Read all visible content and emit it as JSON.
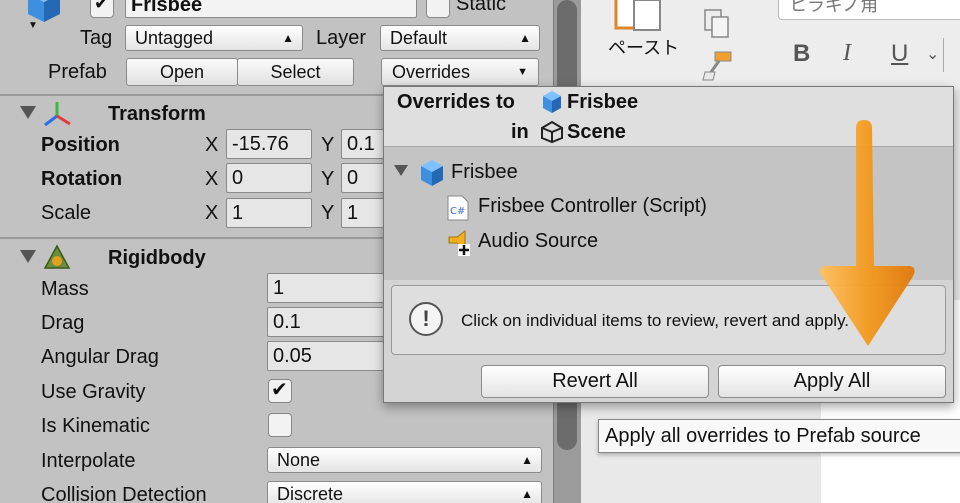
{
  "inspector": {
    "object_name": "Frisbee",
    "static_label": "Static",
    "tag_label": "Tag",
    "tag_value": "Untagged",
    "layer_label": "Layer",
    "layer_value": "Default",
    "prefab_label": "Prefab",
    "open_label": "Open",
    "select_label": "Select",
    "overrides_label": "Overrides",
    "transform": {
      "title": "Transform",
      "position_label": "Position",
      "rotation_label": "Rotation",
      "scale_label": "Scale",
      "x_label": "X",
      "y_label": "Y",
      "position_x": "-15.76",
      "position_y": "0.1",
      "rotation_x": "0",
      "rotation_y": "0",
      "scale_x": "1",
      "scale_y": "1"
    },
    "rigidbody": {
      "title": "Rigidbody",
      "mass_label": "Mass",
      "mass_value": "1",
      "drag_label": "Drag",
      "drag_value": "0.1",
      "angular_drag_label": "Angular Drag",
      "angular_drag_value": "0.05",
      "use_gravity_label": "Use Gravity",
      "use_gravity_checked": true,
      "is_kinematic_label": "Is Kinematic",
      "is_kinematic_checked": false,
      "interpolate_label": "Interpolate",
      "interpolate_value": "None",
      "collision_label": "Collision Detection",
      "collision_value": "Discrete"
    }
  },
  "popup": {
    "title_prefix": "Overrides to",
    "title_object": "Frisbee",
    "in_label": "in",
    "scene_label": "Scene",
    "tree_root": "Frisbee",
    "items": [
      {
        "label": "Frisbee Controller (Script)",
        "icon": "csharp-script-icon"
      },
      {
        "label": "Audio Source",
        "icon": "audio-source-added-icon"
      }
    ],
    "info_text": "Click on individual items to review, revert and apply.",
    "revert_all": "Revert All",
    "apply_all": "Apply All"
  },
  "tooltip": "Apply all overrides to Prefab source",
  "word": {
    "paste_label": "ペースト",
    "font_name": "ヒラギノ角",
    "bold": "B",
    "italic": "I",
    "underline": "U"
  },
  "colors": {
    "inspector_bg": "#c2c2c2",
    "popup_bg": "#d4d4d4",
    "annotation_arrow": "#f39a1e"
  }
}
